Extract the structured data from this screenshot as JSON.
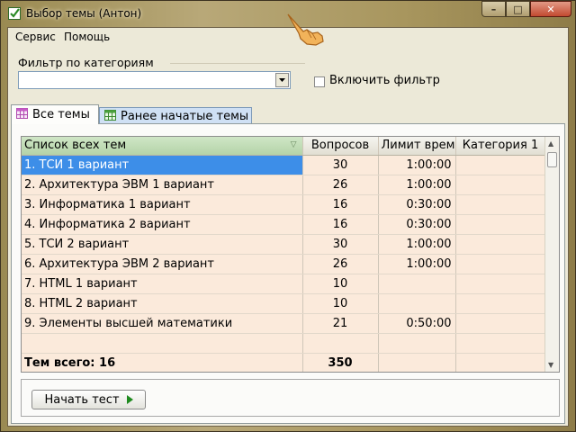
{
  "window": {
    "title": "Выбор темы (Антон)",
    "buttons": {
      "minimize": "–",
      "maximize": "□",
      "close": "✕"
    }
  },
  "menu": {
    "items": [
      "Сервис",
      "Помощь"
    ]
  },
  "filter": {
    "label": "Фильтр по категориям",
    "combo_value": "",
    "enable_label": "Включить фильтр",
    "enabled": false
  },
  "tabs": [
    {
      "label": "Все темы",
      "active": true
    },
    {
      "label": "Ранее начатые темы",
      "active": false
    }
  ],
  "grid": {
    "columns": [
      "Список всех тем",
      "Вопросов",
      "Лимит време",
      "Категория 1"
    ],
    "rows": [
      {
        "name": "1. ТСИ 1 вариант",
        "questions": "30",
        "limit": "1:00:00",
        "category": ""
      },
      {
        "name": "2. Архитектура ЭВМ 1 вариант",
        "questions": "26",
        "limit": "1:00:00",
        "category": ""
      },
      {
        "name": "3. Информатика 1 вариант",
        "questions": "16",
        "limit": "0:30:00",
        "category": ""
      },
      {
        "name": "4. Информатика 2 вариант",
        "questions": "16",
        "limit": "0:30:00",
        "category": ""
      },
      {
        "name": "5. ТСИ 2 вариант",
        "questions": "30",
        "limit": "1:00:00",
        "category": ""
      },
      {
        "name": "6. Архитектура ЭВМ 2 вариант",
        "questions": "26",
        "limit": "1:00:00",
        "category": ""
      },
      {
        "name": "7. HTML 1 вариант",
        "questions": "10",
        "limit": "",
        "category": ""
      },
      {
        "name": "8. HTML 2 вариант",
        "questions": "10",
        "limit": "",
        "category": ""
      },
      {
        "name": "9. Элементы высшей математики",
        "questions": "21",
        "limit": "0:50:00",
        "category": ""
      },
      {
        "name": "",
        "questions": "",
        "limit": "",
        "category": ""
      }
    ],
    "selected_row": 0,
    "total": {
      "label": "Тем всего: 16",
      "questions": "350"
    }
  },
  "start_button": {
    "label": "Начать тест"
  },
  "colors": {
    "selection": "#3d8ee8",
    "row_bg": "#fbeadb",
    "header_first": "#b4d3a8",
    "tab_inactive": "#cfe0f4"
  },
  "icons": [
    "app-check-icon",
    "table-icon",
    "play-icon",
    "dropdown-arrow-icon",
    "hand-cursor-icon"
  ]
}
